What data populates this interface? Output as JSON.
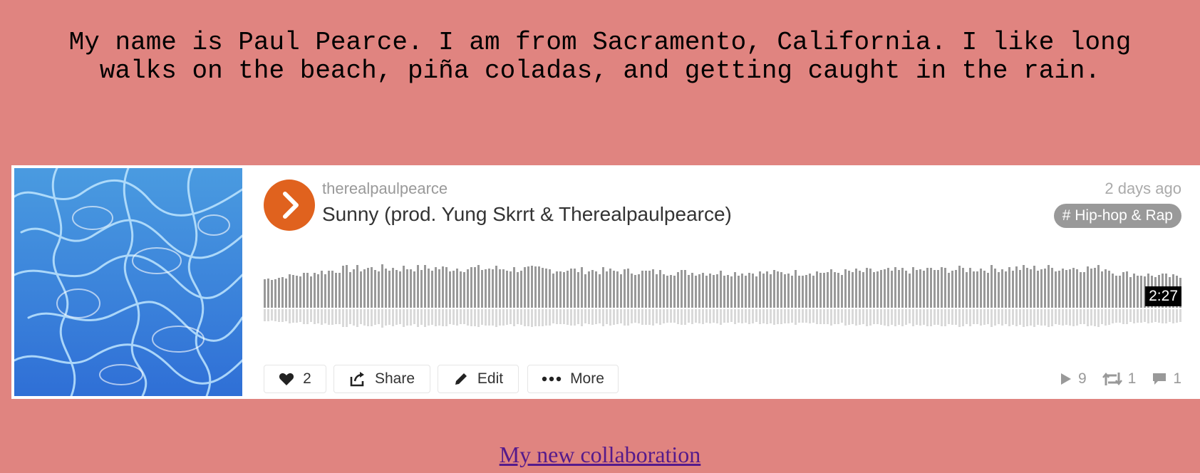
{
  "bio": {
    "text": "My name is Paul Pearce. I am from Sacramento, California. I like long walks on the beach, piña coladas, and getting caught in the rain."
  },
  "player": {
    "uploader": "therealpaulpearce",
    "title": "Sunny (prod. Yung Skrrt & Therealpaulpearce)",
    "posted": "2 days ago",
    "genre": "# Hip-hop & Rap",
    "duration": "2:27",
    "actions": {
      "like_count": "2",
      "share_label": "Share",
      "edit_label": "Edit",
      "more_label": "More"
    },
    "stats": {
      "plays": "9",
      "reposts": "1",
      "comments": "1"
    },
    "colors": {
      "accent": "#e0621e",
      "waveform": "#999999",
      "waveform_reflection": "#d9d9d9"
    },
    "icons": {
      "play": "play-icon",
      "like": "heart-icon",
      "share": "share-icon",
      "edit": "pencil-icon",
      "more": "ellipsis-icon",
      "plays": "play-count-icon",
      "reposts": "repost-icon",
      "comments": "comment-icon"
    }
  },
  "link": {
    "text": "My new collaboration"
  },
  "page": {
    "background": "#e08480"
  }
}
